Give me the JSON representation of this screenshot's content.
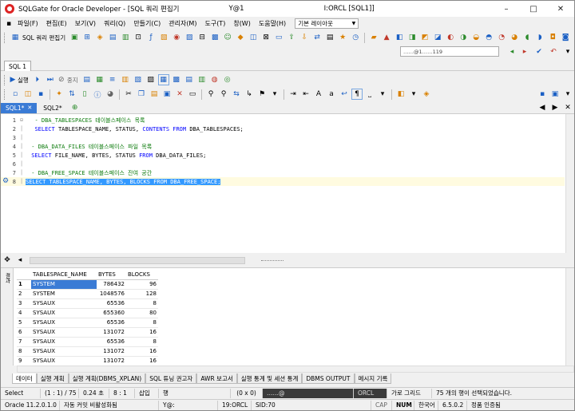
{
  "window": {
    "title": "SQLGate for Oracle Developer - [SQL 쿼리 편집기",
    "title_user": "Y@1",
    "title_conn": "I:ORCL [SQL1]]",
    "controls": [
      "–",
      "□",
      "✕"
    ]
  },
  "menu": {
    "items": [
      "파일(F)",
      "편집(E)",
      "보기(V)",
      "쿼리(Q)",
      "만들기(C)",
      "관리자(M)",
      "도구(T)",
      "창(W)",
      "도움말(H)"
    ],
    "layout_select": "기본 레이아웃"
  },
  "toolbar1": {
    "sql_editor_label": "SQL 쿼리 편집기"
  },
  "connection_select": "……@1……119",
  "doc_tabs": {
    "sql1": "SQL 1"
  },
  "exec_toolbar": {
    "run_label": "실행",
    "stop_label": "중지"
  },
  "editor_tabs": [
    {
      "label": "SQL1*",
      "active": true
    },
    {
      "label": "SQL2*",
      "active": false
    }
  ],
  "editor": {
    "lines": [
      {
        "n": "1",
        "comment": "- DBA_TABLESPACES 테이블스페이스 목록"
      },
      {
        "n": "2",
        "kw1": "SELECT",
        "a": " TABLESPACE_NAME, STATUS, ",
        "kw2": "CONTENTS FROM",
        "b": " DBA_TABLESPACES;"
      },
      {
        "n": "3"
      },
      {
        "n": "4",
        "comment": "- DBA_DATA_FILES 테이블스페이스 파일 목록"
      },
      {
        "n": "5",
        "kw1": "SELECT",
        "a": " FILE_NAME, BYTES, STATUS ",
        "kw2": "FROM",
        "b": " DBA_DATA_FILES;"
      },
      {
        "n": "6"
      },
      {
        "n": "7",
        "comment": "- DBA_FREE_SPACE 테이블스페이스 잔여 공간"
      },
      {
        "n": "8",
        "selected": "SELECT TABLESPACE_NAME, BYTES, BLOCKS FROM DBA_FREE_SPACE;"
      }
    ]
  },
  "grid": {
    "side_label": "결과",
    "columns": [
      "TABLESPACE_NAME",
      "BYTES",
      "BLOCKS"
    ],
    "rows": [
      [
        "1",
        "SYSTEM",
        "786432",
        "96"
      ],
      [
        "2",
        "SYSTEM",
        "1048576",
        "128"
      ],
      [
        "3",
        "SYSAUX",
        "65536",
        "8"
      ],
      [
        "4",
        "SYSAUX",
        "655360",
        "80"
      ],
      [
        "5",
        "SYSAUX",
        "65536",
        "8"
      ],
      [
        "6",
        "SYSAUX",
        "131072",
        "16"
      ],
      [
        "7",
        "SYSAUX",
        "65536",
        "8"
      ],
      [
        "8",
        "SYSAUX",
        "131072",
        "16"
      ],
      [
        "9",
        "SYSAUX",
        "131072",
        "16"
      ]
    ]
  },
  "bottom_tabs": [
    "데이터",
    "실행 계획",
    "실행 계획(DBMS_XPLAN)",
    "SQL 튜닝 권고자",
    "AWR 보고서",
    "실행 통계 및 세션 통계",
    "DBMS OUTPUT",
    "메시지 기록"
  ],
  "status1": {
    "mode": "Select",
    "position": "(1 : 1) / 75",
    "time": "0.24 초",
    "ratio": "8 : 1",
    "insert": "삽입",
    "row": "행",
    "coords": "(0 x 0)",
    "conn": "……@",
    "db": "ORCL",
    "grid_label": "가로 그리드",
    "info": "75 개의 행이 선택되었습니다."
  },
  "status2": {
    "version": "Oracle 11.2.0.1.0",
    "autocommit": "자동 커밋 비활성화됨",
    "user": "Y@:",
    "conn": "19:ORCL",
    "sid": "SID:70",
    "caps": "CAP",
    "num": "NUM",
    "lang": "한국어",
    "app_version": "6.5.0.2",
    "license": "정품 인증됨"
  }
}
